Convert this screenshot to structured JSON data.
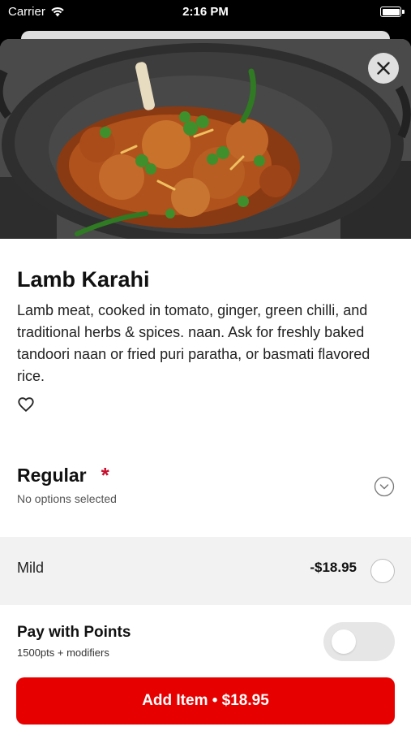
{
  "status_bar": {
    "carrier": "Carrier",
    "time": "2:16 PM",
    "icons": [
      "wifi-icon",
      "battery-icon"
    ]
  },
  "hero": {
    "image_icon": "food-photo",
    "close_icon": "close-icon"
  },
  "item": {
    "title": "Lamb Karahi",
    "description": "Lamb meat, cooked in tomato, ginger, green chilli, and traditional herbs & spices. naan. Ask for freshly baked tandoori naan or fried puri paratha, or basmati flavored rice.",
    "favorite_icon": "heart-icon"
  },
  "option_group": {
    "title": "Regular",
    "required_mark": "*",
    "subtitle": "No options selected",
    "expand_icon": "chevron-down-icon",
    "options": [
      {
        "label": "Mild",
        "price": "-$18.95",
        "selected": false
      }
    ]
  },
  "points": {
    "title": "Pay with Points",
    "subtitle": "1500pts + modifiers",
    "enabled": false
  },
  "cta": {
    "label": "Add Item • $18.95"
  },
  "colors": {
    "accent": "#e60000",
    "required": "#c8102e",
    "row_bg": "#f2f2f2",
    "toggle_off": "#e6e6e6"
  }
}
